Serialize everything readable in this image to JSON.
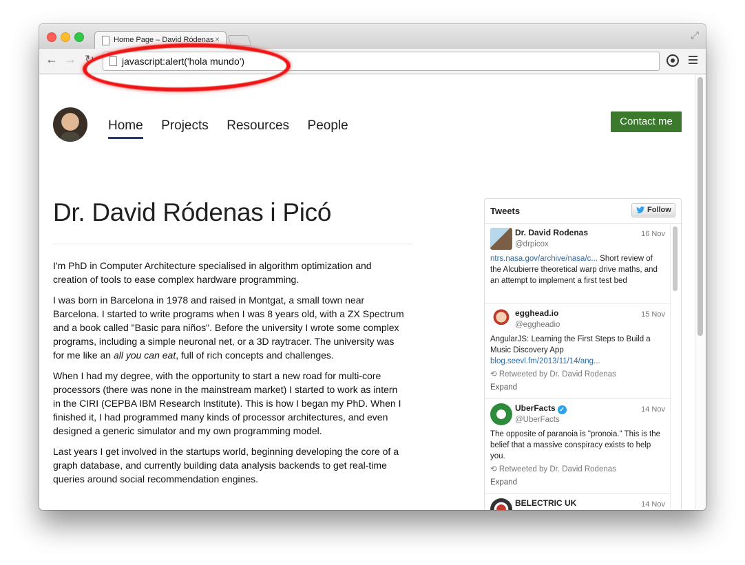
{
  "browser": {
    "tab_title": "Home Page – David Ródenas",
    "tab_close": "×",
    "url": "javascript:alert('hola mundo')"
  },
  "site": {
    "nav": [
      {
        "label": "Home",
        "active": true
      },
      {
        "label": "Projects",
        "active": false
      },
      {
        "label": "Resources",
        "active": false
      },
      {
        "label": "People",
        "active": false
      }
    ],
    "contact_label": "Contact me",
    "headline": "Dr. David Ródenas i Picó",
    "bio": {
      "p1": "I'm PhD in Computer Architecture specialised in algorithm optimization and creation of tools to ease complex hardware programming.",
      "p2_before": "I was born in Barcelona in 1978 and raised in Montgat, a small town near Barcelona. I started to write programs when I was 8 years old, with a ZX Spectrum and a book called \"Basic para niños\". Before the university I wrote some complex programs, including a simple neuronal net, or a 3D raytracer. The university was for me like an ",
      "p2_em": "all you can eat",
      "p2_after": ", full of rich concepts and challenges.",
      "p3": "When I had my degree, with the opportunity to start a new road for multi-core processors (there was none in the mainstream market) I started to work as intern in the CIRI (CEPBA IBM Research Institute). This is how I began my PhD. When I finished it, I had programmed many kinds of processor architectures, and even designed a generic simulator and my own programming model.",
      "p4": "Last years I get involved in the startups world, beginning developing the core of a graph database, and currently building data analysis backends to get real-time queries around social recommendation engines."
    }
  },
  "tweets_widget": {
    "title": "Tweets",
    "follow_label": "Follow",
    "tweets": [
      {
        "name": "Dr. David Rodenas",
        "handle": "@drpicox",
        "date": "16 Nov",
        "link": "ntrs.nasa.gov/archive/nasa/c...",
        "text": " Short review of the Alcubierre theoretical warp drive maths, and an attempt to implement a first test bed"
      },
      {
        "name": "egghead.io",
        "handle": "@eggheadio",
        "date": "15 Nov",
        "text": "AngularJS: Learning the First Steps to Build a Music Discovery App",
        "link": "blog.seevl.fm/2013/11/14/ang...",
        "retweet": "Retweeted by Dr. David Rodenas",
        "expand": "Expand"
      },
      {
        "name": "UberFacts",
        "handle": "@UberFacts",
        "date": "14 Nov",
        "text": "The opposite of paranoia is \"pronoia.\" This is the belief that a massive conspiracy exists to help you.",
        "retweet": "Retweeted by Dr. David Rodenas",
        "expand": "Expand"
      },
      {
        "name": "BELECTRIC UK",
        "date": "14 Nov"
      }
    ]
  },
  "colors": {
    "contact_button": "#3b7a2c",
    "active_underline": "#1e3f73",
    "highlight": "#ee1515",
    "tweet_link": "#2a6ba8"
  }
}
